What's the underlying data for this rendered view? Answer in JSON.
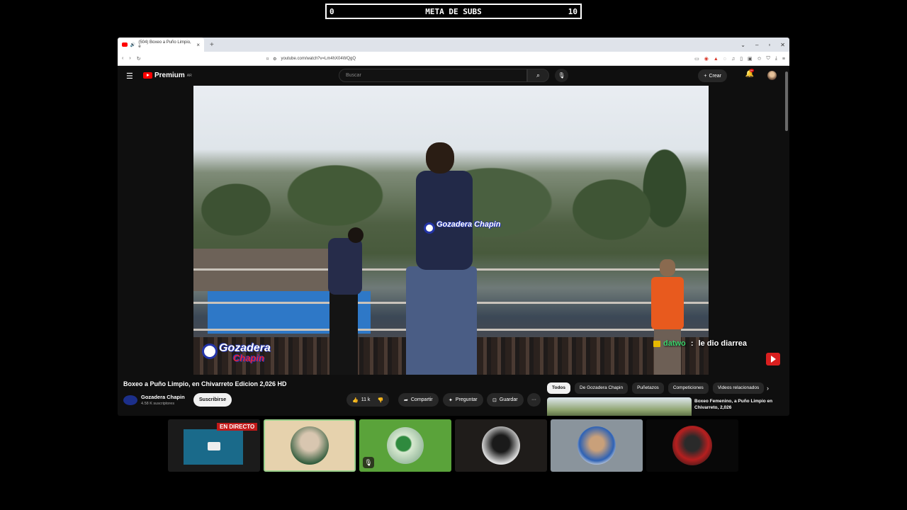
{
  "subgoal": {
    "left": "0",
    "title": "META DE SUBS",
    "right": "10"
  },
  "browser": {
    "tab_title": "(504) Boxeo a Puño Limpio, e",
    "url": "youtube.com/watch?v=Lm4hX04WQgQ"
  },
  "youtube": {
    "logo": "Premium",
    "logo_sup": "AR",
    "search_placeholder": "Buscar",
    "create_label": "Crear",
    "notif_badge": "9+",
    "video_title": "Boxeo a Puño Limpio, en Chivarreto Edicion 2,026 HD",
    "channel_name": "Gozadera Chapin",
    "channel_subs": "4.58 K suscriptores",
    "subscribe_label": "Suscribirse",
    "like_count": "11 k",
    "share_label": "Compartir",
    "ask_label": "Preguntar",
    "save_label": "Guardar",
    "more_label": "···",
    "watermark_small": "Gozadera Chapin",
    "watermark_big_1": "Gozadera",
    "watermark_big_2": "Chapin",
    "chips": [
      "Todos",
      "De Gozadera Chapin",
      "Puñetazos",
      "Competiciones",
      "Videos relacionados"
    ],
    "rec_title": "Boxeo Femenino, a Puño Limpio en Chivarreto, 2,026"
  },
  "chat": {
    "user": "datwo",
    "separator": " : ",
    "message": "le dio diarrea"
  },
  "overlay": {
    "live_badge": "EN DIRECTO"
  },
  "colors": {
    "yt_red": "#ff0000",
    "chat_user": "#39d26b",
    "live_red": "#c21a1a"
  }
}
